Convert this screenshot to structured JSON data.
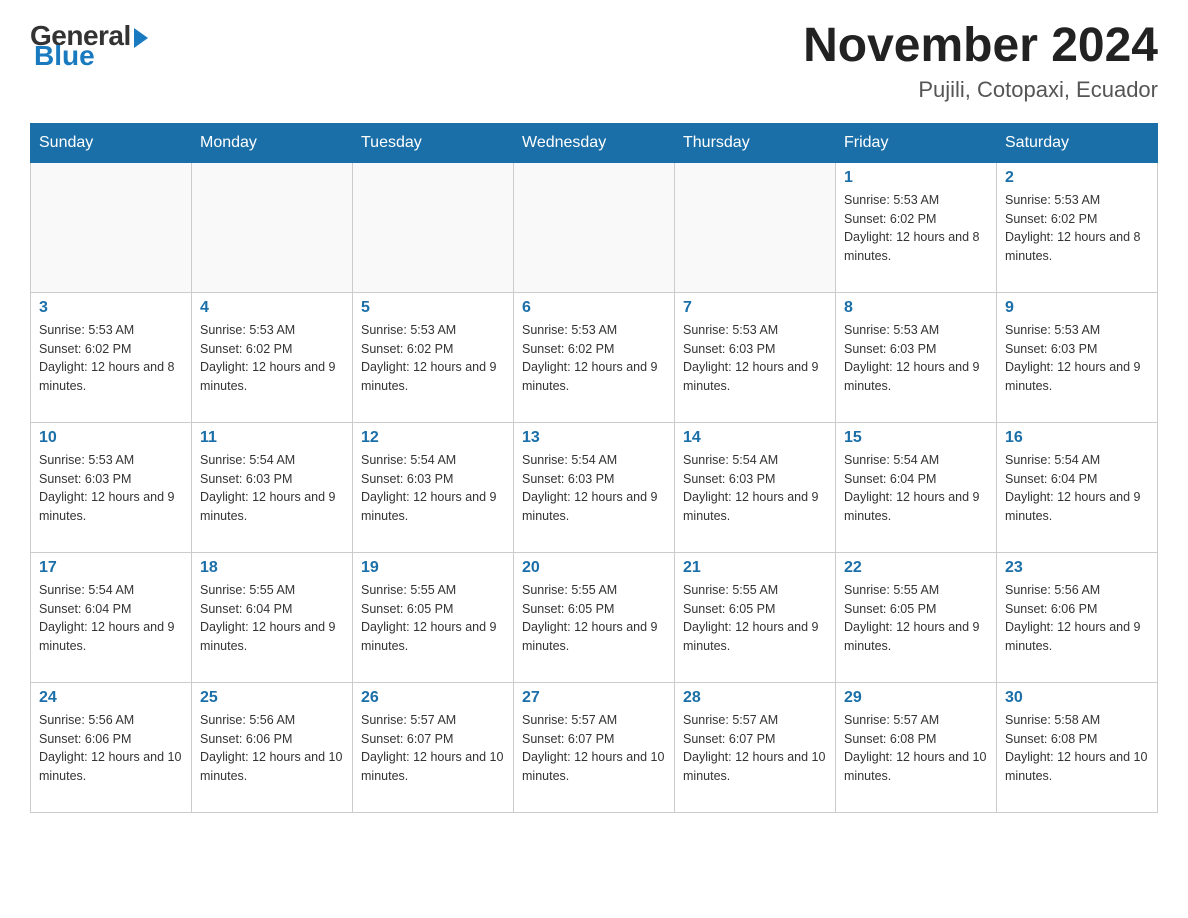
{
  "header": {
    "logo": {
      "general": "General",
      "blue": "Blue"
    },
    "month": "November 2024",
    "location": "Pujili, Cotopaxi, Ecuador"
  },
  "weekdays": [
    "Sunday",
    "Monday",
    "Tuesday",
    "Wednesday",
    "Thursday",
    "Friday",
    "Saturday"
  ],
  "weeks": [
    [
      {
        "day": "",
        "sunrise": "",
        "sunset": "",
        "daylight": ""
      },
      {
        "day": "",
        "sunrise": "",
        "sunset": "",
        "daylight": ""
      },
      {
        "day": "",
        "sunrise": "",
        "sunset": "",
        "daylight": ""
      },
      {
        "day": "",
        "sunrise": "",
        "sunset": "",
        "daylight": ""
      },
      {
        "day": "",
        "sunrise": "",
        "sunset": "",
        "daylight": ""
      },
      {
        "day": "1",
        "sunrise": "Sunrise: 5:53 AM",
        "sunset": "Sunset: 6:02 PM",
        "daylight": "Daylight: 12 hours and 8 minutes."
      },
      {
        "day": "2",
        "sunrise": "Sunrise: 5:53 AM",
        "sunset": "Sunset: 6:02 PM",
        "daylight": "Daylight: 12 hours and 8 minutes."
      }
    ],
    [
      {
        "day": "3",
        "sunrise": "Sunrise: 5:53 AM",
        "sunset": "Sunset: 6:02 PM",
        "daylight": "Daylight: 12 hours and 8 minutes."
      },
      {
        "day": "4",
        "sunrise": "Sunrise: 5:53 AM",
        "sunset": "Sunset: 6:02 PM",
        "daylight": "Daylight: 12 hours and 9 minutes."
      },
      {
        "day": "5",
        "sunrise": "Sunrise: 5:53 AM",
        "sunset": "Sunset: 6:02 PM",
        "daylight": "Daylight: 12 hours and 9 minutes."
      },
      {
        "day": "6",
        "sunrise": "Sunrise: 5:53 AM",
        "sunset": "Sunset: 6:02 PM",
        "daylight": "Daylight: 12 hours and 9 minutes."
      },
      {
        "day": "7",
        "sunrise": "Sunrise: 5:53 AM",
        "sunset": "Sunset: 6:03 PM",
        "daylight": "Daylight: 12 hours and 9 minutes."
      },
      {
        "day": "8",
        "sunrise": "Sunrise: 5:53 AM",
        "sunset": "Sunset: 6:03 PM",
        "daylight": "Daylight: 12 hours and 9 minutes."
      },
      {
        "day": "9",
        "sunrise": "Sunrise: 5:53 AM",
        "sunset": "Sunset: 6:03 PM",
        "daylight": "Daylight: 12 hours and 9 minutes."
      }
    ],
    [
      {
        "day": "10",
        "sunrise": "Sunrise: 5:53 AM",
        "sunset": "Sunset: 6:03 PM",
        "daylight": "Daylight: 12 hours and 9 minutes."
      },
      {
        "day": "11",
        "sunrise": "Sunrise: 5:54 AM",
        "sunset": "Sunset: 6:03 PM",
        "daylight": "Daylight: 12 hours and 9 minutes."
      },
      {
        "day": "12",
        "sunrise": "Sunrise: 5:54 AM",
        "sunset": "Sunset: 6:03 PM",
        "daylight": "Daylight: 12 hours and 9 minutes."
      },
      {
        "day": "13",
        "sunrise": "Sunrise: 5:54 AM",
        "sunset": "Sunset: 6:03 PM",
        "daylight": "Daylight: 12 hours and 9 minutes."
      },
      {
        "day": "14",
        "sunrise": "Sunrise: 5:54 AM",
        "sunset": "Sunset: 6:03 PM",
        "daylight": "Daylight: 12 hours and 9 minutes."
      },
      {
        "day": "15",
        "sunrise": "Sunrise: 5:54 AM",
        "sunset": "Sunset: 6:04 PM",
        "daylight": "Daylight: 12 hours and 9 minutes."
      },
      {
        "day": "16",
        "sunrise": "Sunrise: 5:54 AM",
        "sunset": "Sunset: 6:04 PM",
        "daylight": "Daylight: 12 hours and 9 minutes."
      }
    ],
    [
      {
        "day": "17",
        "sunrise": "Sunrise: 5:54 AM",
        "sunset": "Sunset: 6:04 PM",
        "daylight": "Daylight: 12 hours and 9 minutes."
      },
      {
        "day": "18",
        "sunrise": "Sunrise: 5:55 AM",
        "sunset": "Sunset: 6:04 PM",
        "daylight": "Daylight: 12 hours and 9 minutes."
      },
      {
        "day": "19",
        "sunrise": "Sunrise: 5:55 AM",
        "sunset": "Sunset: 6:05 PM",
        "daylight": "Daylight: 12 hours and 9 minutes."
      },
      {
        "day": "20",
        "sunrise": "Sunrise: 5:55 AM",
        "sunset": "Sunset: 6:05 PM",
        "daylight": "Daylight: 12 hours and 9 minutes."
      },
      {
        "day": "21",
        "sunrise": "Sunrise: 5:55 AM",
        "sunset": "Sunset: 6:05 PM",
        "daylight": "Daylight: 12 hours and 9 minutes."
      },
      {
        "day": "22",
        "sunrise": "Sunrise: 5:55 AM",
        "sunset": "Sunset: 6:05 PM",
        "daylight": "Daylight: 12 hours and 9 minutes."
      },
      {
        "day": "23",
        "sunrise": "Sunrise: 5:56 AM",
        "sunset": "Sunset: 6:06 PM",
        "daylight": "Daylight: 12 hours and 9 minutes."
      }
    ],
    [
      {
        "day": "24",
        "sunrise": "Sunrise: 5:56 AM",
        "sunset": "Sunset: 6:06 PM",
        "daylight": "Daylight: 12 hours and 10 minutes."
      },
      {
        "day": "25",
        "sunrise": "Sunrise: 5:56 AM",
        "sunset": "Sunset: 6:06 PM",
        "daylight": "Daylight: 12 hours and 10 minutes."
      },
      {
        "day": "26",
        "sunrise": "Sunrise: 5:57 AM",
        "sunset": "Sunset: 6:07 PM",
        "daylight": "Daylight: 12 hours and 10 minutes."
      },
      {
        "day": "27",
        "sunrise": "Sunrise: 5:57 AM",
        "sunset": "Sunset: 6:07 PM",
        "daylight": "Daylight: 12 hours and 10 minutes."
      },
      {
        "day": "28",
        "sunrise": "Sunrise: 5:57 AM",
        "sunset": "Sunset: 6:07 PM",
        "daylight": "Daylight: 12 hours and 10 minutes."
      },
      {
        "day": "29",
        "sunrise": "Sunrise: 5:57 AM",
        "sunset": "Sunset: 6:08 PM",
        "daylight": "Daylight: 12 hours and 10 minutes."
      },
      {
        "day": "30",
        "sunrise": "Sunrise: 5:58 AM",
        "sunset": "Sunset: 6:08 PM",
        "daylight": "Daylight: 12 hours and 10 minutes."
      }
    ]
  ]
}
